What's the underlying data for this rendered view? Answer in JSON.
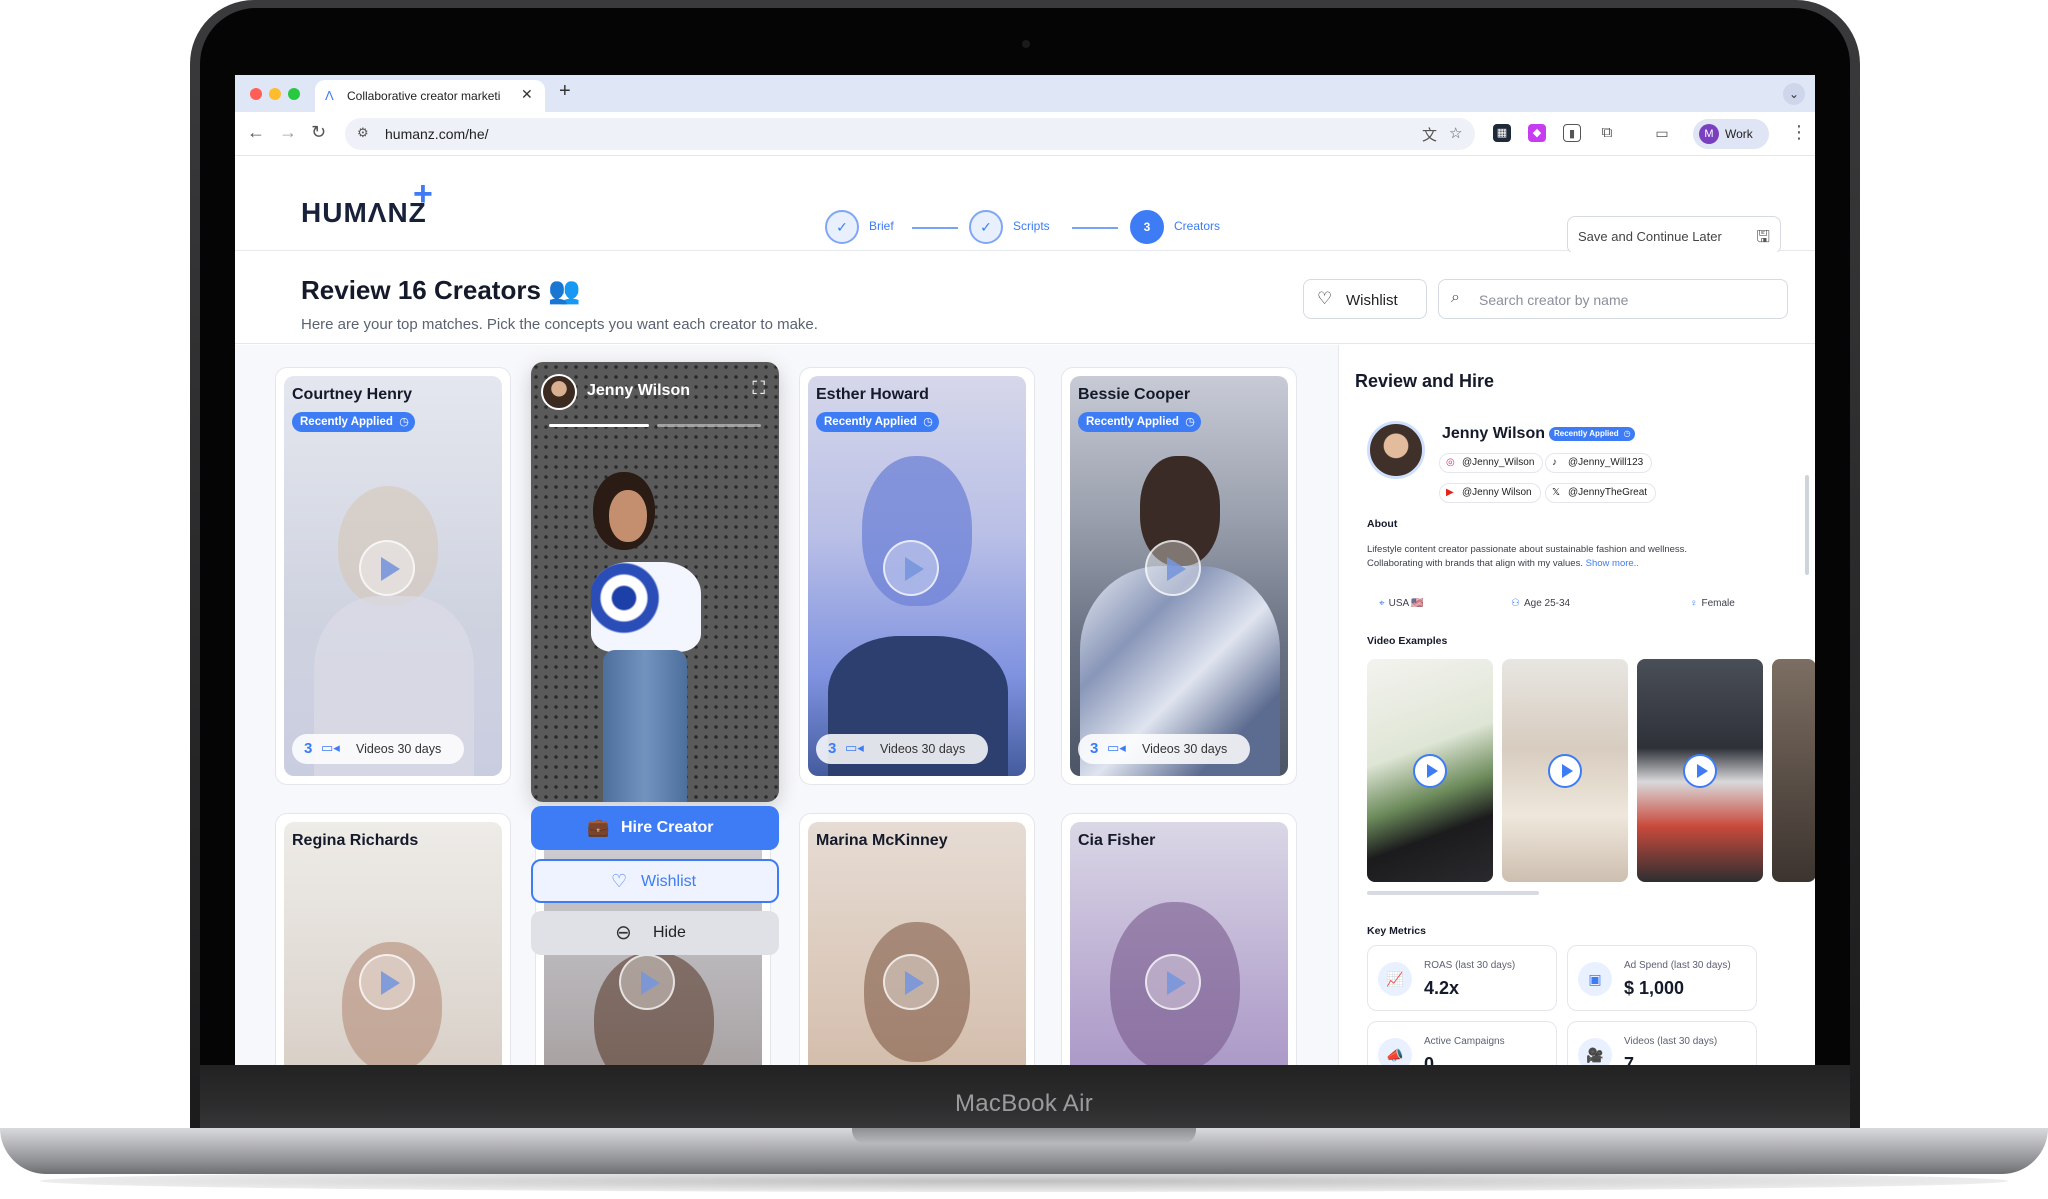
{
  "device": {
    "label": "MacBook Air"
  },
  "browser": {
    "tab_title": "Collaborative creator marketi",
    "url": "humanz.com/he/",
    "profile_initial": "M",
    "profile_label": "Work"
  },
  "app": {
    "logo": "HUMΛNZ",
    "logo_mark": "+",
    "steps": [
      {
        "label": "Brief",
        "icon": "check-icon",
        "state": "done"
      },
      {
        "label": "Scripts",
        "icon": "check-icon",
        "state": "done"
      },
      {
        "label": "Creators",
        "number": "3",
        "state": "active"
      }
    ],
    "save_later": "Save and Continue Later"
  },
  "page": {
    "title": "Review 16 Creators 👥",
    "subtitle": "Here are your top matches. Pick the concepts you want each creator to make.",
    "wishlist": "Wishlist",
    "search_placeholder": "Search creator by name"
  },
  "cards": [
    {
      "name": "Courtney Henry",
      "badge": "Recently Applied",
      "count": "3",
      "videos": "Videos 30 days"
    },
    {
      "name": "Esther Howard",
      "badge": "Recently Applied",
      "count": "3",
      "videos": "Videos 30 days"
    },
    {
      "name": "Bessie Cooper",
      "badge": "Recently Applied",
      "count": "3",
      "videos": "Videos 30 days"
    },
    {
      "name": "Regina Richards"
    },
    {
      "name": "Marina McKinney"
    },
    {
      "name": "Cia Fisher"
    }
  ],
  "focus": {
    "name": "Jenny Wilson",
    "hire": "Hire Creator",
    "wishlist": "Wishlist",
    "hide": "Hide"
  },
  "panel": {
    "title": "Review and Hire",
    "name": "Jenny Wilson",
    "badge": "Recently Applied",
    "socials": [
      {
        "platform": "instagram",
        "handle": "@Jenny_Wilson"
      },
      {
        "platform": "tiktok",
        "handle": "@Jenny_Will123"
      },
      {
        "platform": "youtube",
        "handle": "@Jenny Wilson"
      },
      {
        "platform": "x",
        "handle": "@JennyTheGreat"
      }
    ],
    "about_heading": "About",
    "about_text": "Lifestyle content creator passionate about sustainable fashion and wellness. Collaborating with brands that align with my values.",
    "about_more": "Show more..",
    "location": "USA 🇺🇸",
    "age_label": "Age",
    "age": "25-34",
    "gender": "Female",
    "video_heading": "Video Examples",
    "metrics_heading": "Key Metrics",
    "metrics": [
      {
        "label": "ROAS (last 30 days)",
        "value": "4.2x",
        "icon": "chart-icon"
      },
      {
        "label": "Ad Spend (last 30 days)",
        "value": "$ 1,000",
        "icon": "money-icon"
      },
      {
        "label": "Active Campaigns",
        "value": "0",
        "icon": "megaphone-icon"
      },
      {
        "label": "Videos (last 30 days)",
        "value": "7",
        "icon": "video-icon"
      }
    ]
  },
  "colors": {
    "accent": "#3d7cf5",
    "text": "#151a2b"
  }
}
